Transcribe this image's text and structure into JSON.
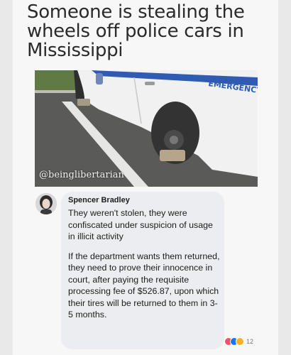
{
  "headline": "Someone is stealing the wheels off police cars in Mississippi",
  "photo": {
    "watermark": "@beinglibertarian",
    "car_text": "EMERGENCY"
  },
  "comment": {
    "author": "Spencer Bradley",
    "paragraphs": [
      "They weren't stolen, they were confiscated under suspicion of usage in illicit activity",
      "If the department wants them returned, they need to prove their innocence in court, after paying the requisite processing fee of $526.87, upon which their tires will be returned to them in 3-5 months."
    ],
    "reaction_count": "12",
    "reaction_colors": [
      "#f25268",
      "#1877f2",
      "#f7b125"
    ]
  }
}
